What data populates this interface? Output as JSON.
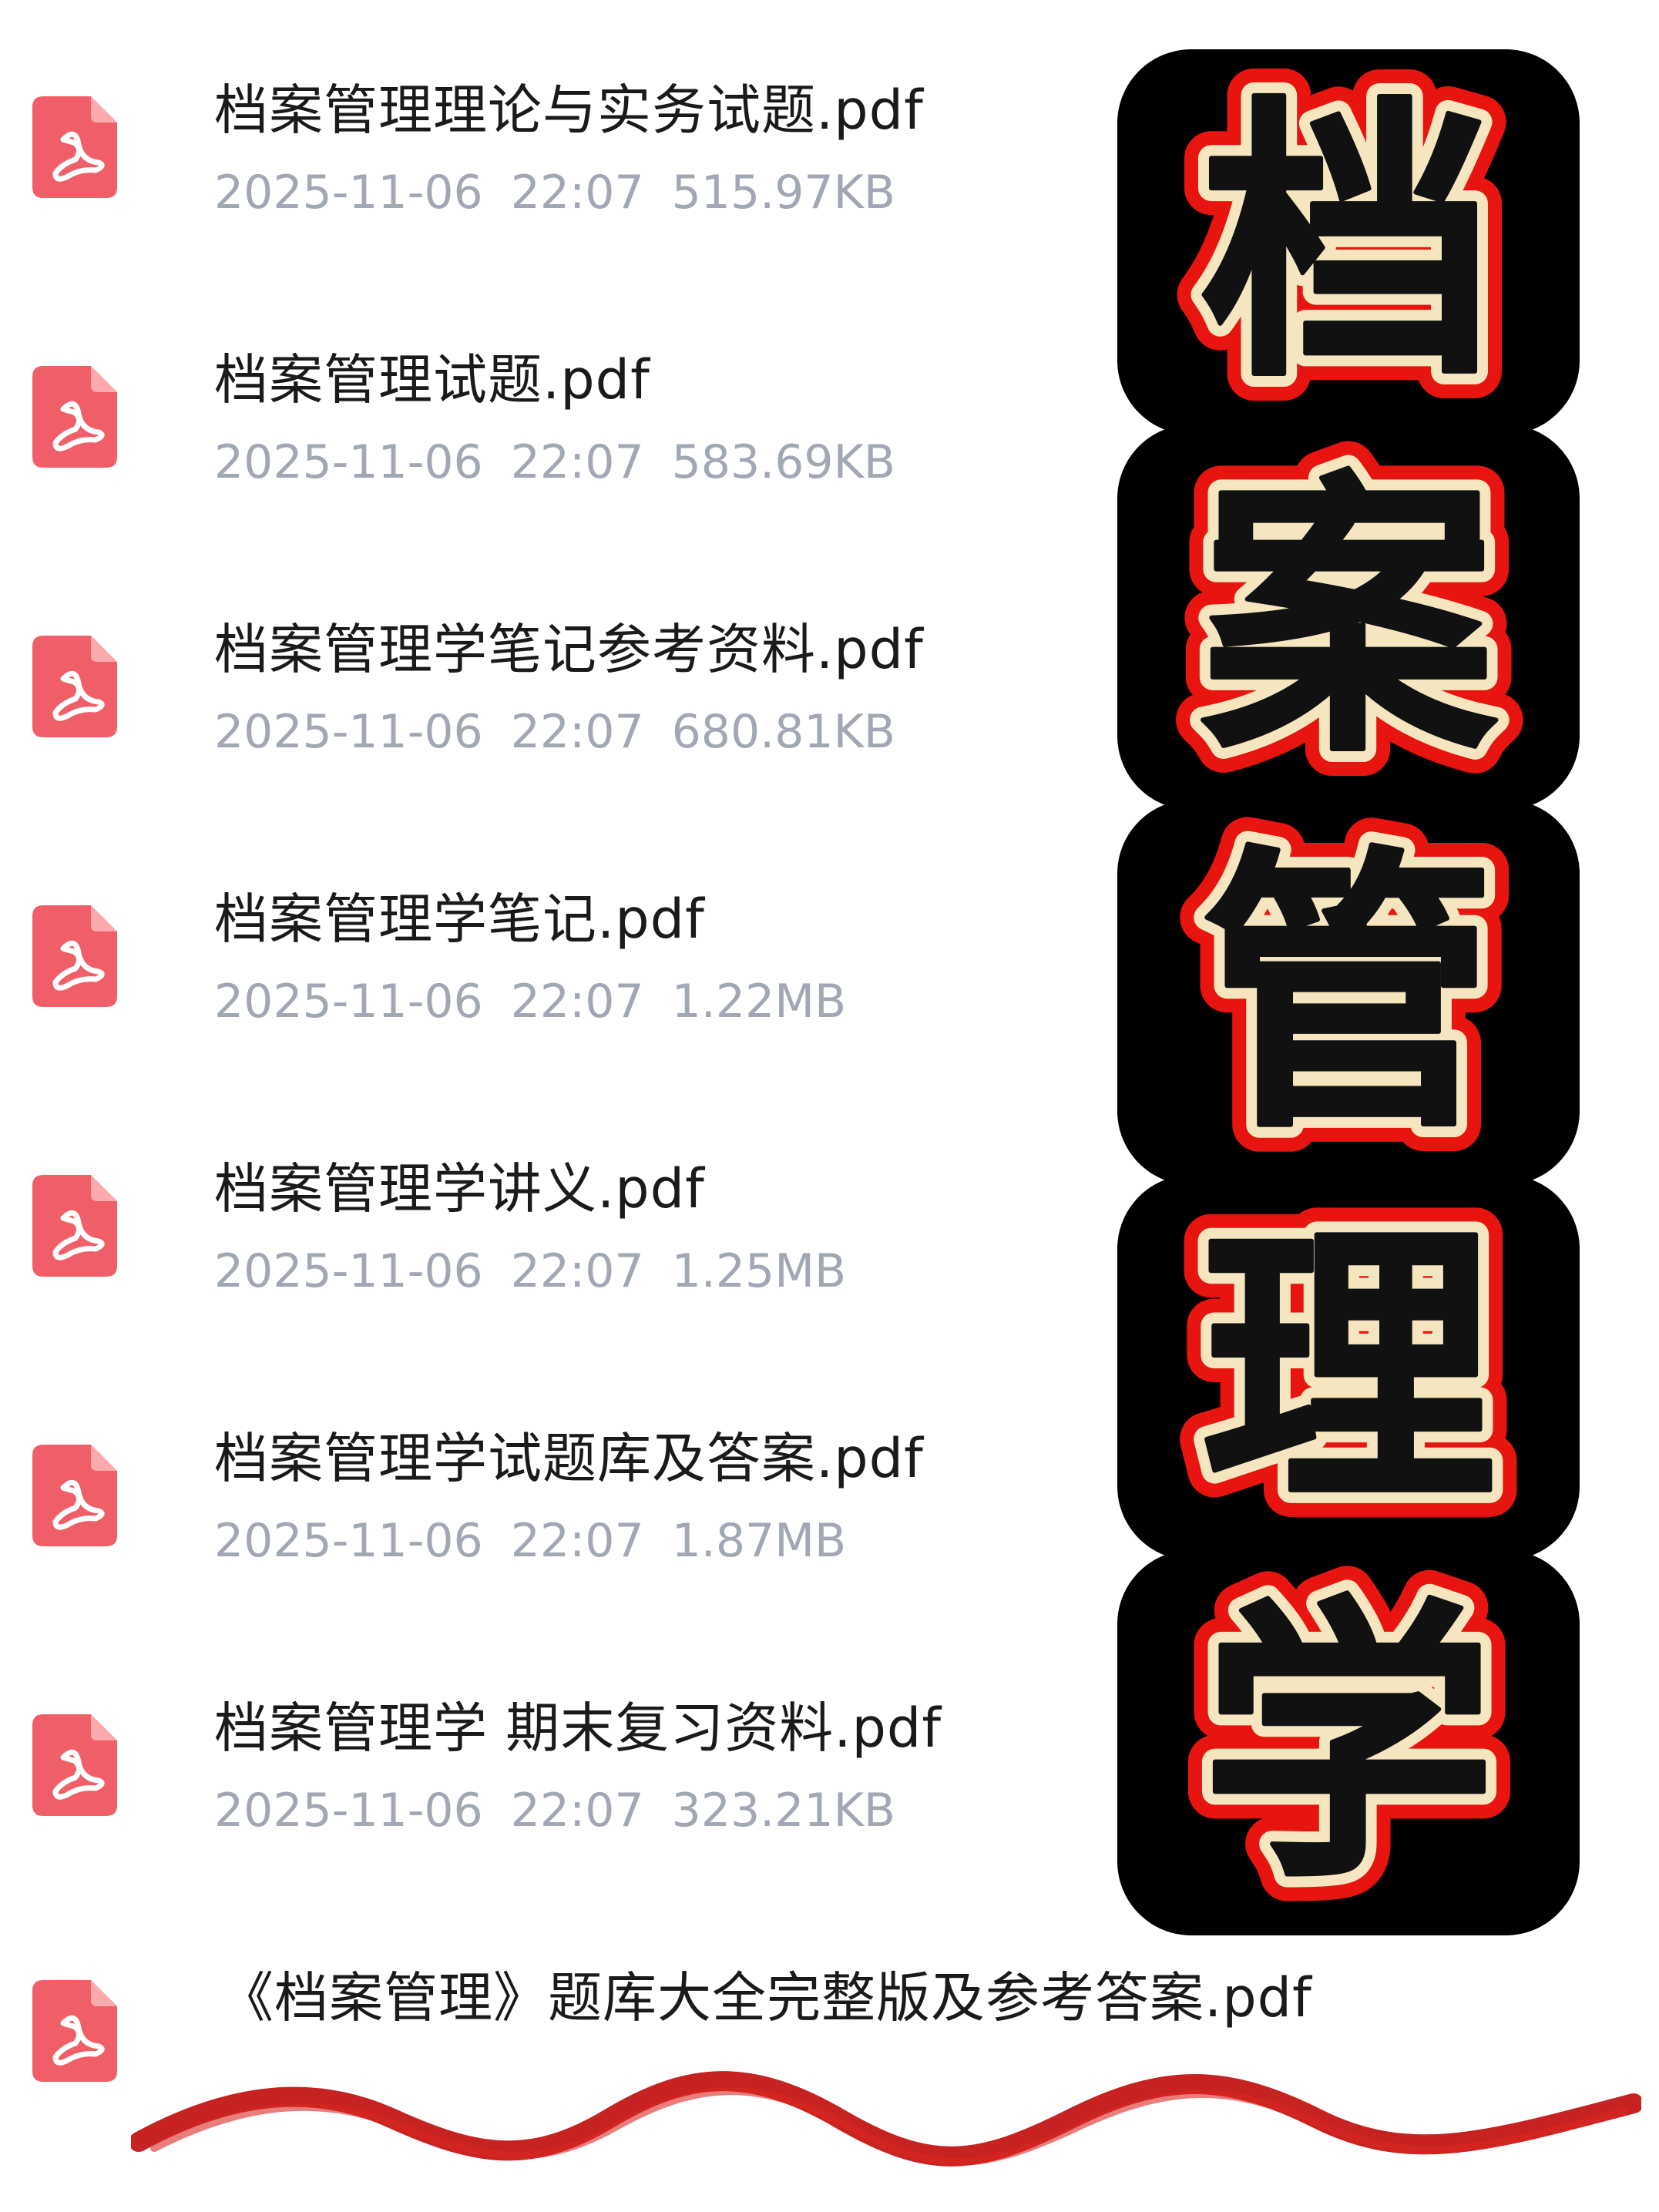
{
  "files": [
    {
      "name": "档案管理理论与实务试题.pdf",
      "date": "2025-11-06",
      "time": "22:07",
      "size": "515.97KB"
    },
    {
      "name": "档案管理试题.pdf",
      "date": "2025-11-06",
      "time": "22:07",
      "size": "583.69KB"
    },
    {
      "name": "档案管理学笔记参考资料.pdf",
      "date": "2025-11-06",
      "time": "22:07",
      "size": "680.81KB"
    },
    {
      "name": "档案管理学笔记.pdf",
      "date": "2025-11-06",
      "time": "22:07",
      "size": "1.22MB"
    },
    {
      "name": "档案管理学讲义.pdf",
      "date": "2025-11-06",
      "time": "22:07",
      "size": "1.25MB"
    },
    {
      "name": "档案管理学试题库及答案.pdf",
      "date": "2025-11-06",
      "time": "22:07",
      "size": "1.87MB"
    },
    {
      "name": "档案管理学 期末复习资料.pdf",
      "date": "2025-11-06",
      "time": "22:07",
      "size": "323.21KB"
    },
    {
      "name": "《档案管理》题库大全完整版及参考答案.pdf"
    }
  ],
  "title_banner": {
    "chars": [
      "档",
      "案",
      "管",
      "理",
      "学"
    ]
  },
  "icons": {
    "file": "pdf-file-icon",
    "decoration": "red-brush-wave"
  },
  "colors": {
    "icon_red": "#f05f68",
    "meta_gray": "#a2a7b4",
    "name_black": "#1a1a1a",
    "tile_black": "#000000",
    "glyph_cream": "#f6e6c0",
    "glyph_red": "#e8140f",
    "wave_red": "#c41616"
  }
}
